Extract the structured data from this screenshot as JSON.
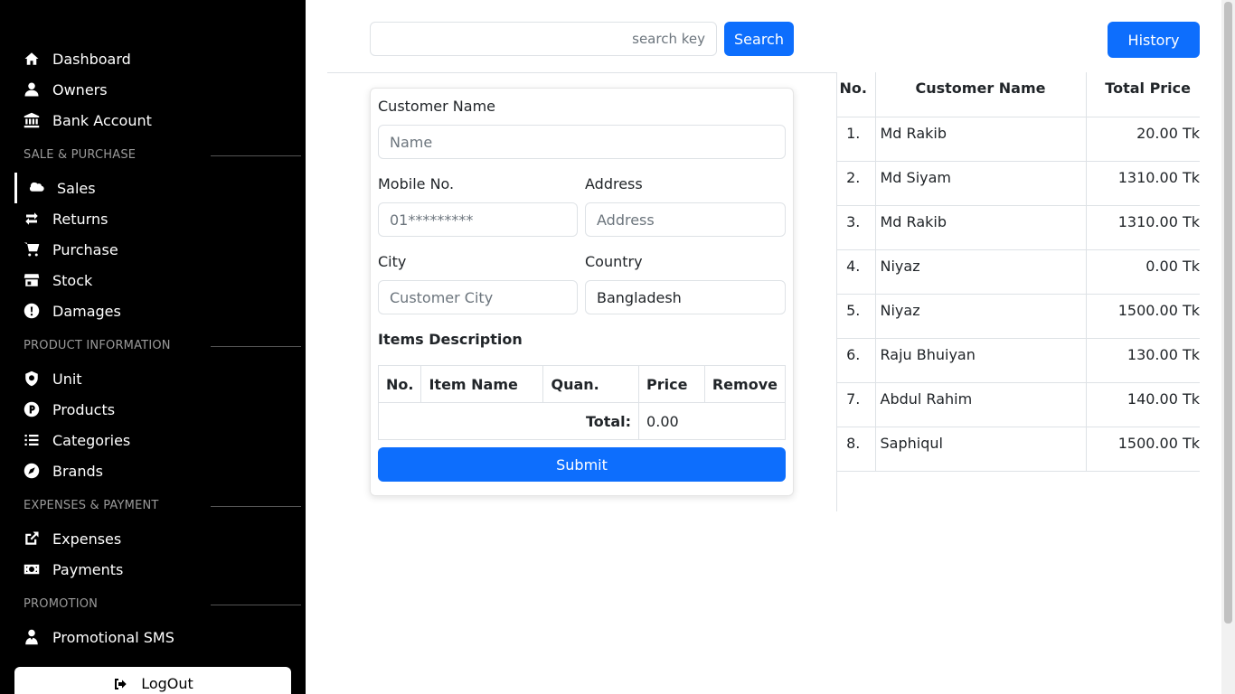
{
  "sidebar": {
    "items": [
      {
        "label": "Dashboard",
        "icon": "home-icon"
      },
      {
        "label": "Owners",
        "icon": "user-icon"
      },
      {
        "label": "Bank Account",
        "icon": "bank-icon"
      },
      {
        "label": "Sales",
        "icon": "salesforce-cloud-icon",
        "active": true
      },
      {
        "label": "Returns",
        "icon": "swap-arrows-icon"
      },
      {
        "label": "Purchase",
        "icon": "cart-icon"
      },
      {
        "label": "Stock",
        "icon": "store-icon"
      },
      {
        "label": "Damages",
        "icon": "alert-circle-icon"
      },
      {
        "label": "Unit",
        "icon": "shield-icon"
      },
      {
        "label": "Products",
        "icon": "product-p-icon"
      },
      {
        "label": "Categories",
        "icon": "list-icon"
      },
      {
        "label": "Brands",
        "icon": "compass-icon"
      },
      {
        "label": "Expenses",
        "icon": "external-link-icon"
      },
      {
        "label": "Payments",
        "icon": "money-bill-icon"
      },
      {
        "label": "Promotional SMS",
        "icon": "user-tie-icon"
      }
    ],
    "sections": [
      "SALE & PURCHASE",
      "PRODUCT INFORMATION",
      "EXPENSES & PAYMENT",
      "PROMOTION"
    ],
    "logout_label": "LogOut"
  },
  "topbar": {
    "search_placeholder": "search key",
    "search_button": "Search",
    "history_button": "History"
  },
  "form": {
    "customer_name_label": "Customer Name",
    "customer_name_placeholder": "Name",
    "mobile_label": "Mobile No.",
    "mobile_placeholder": "01*********",
    "address_label": "Address",
    "address_placeholder": "Address",
    "city_label": "City",
    "city_placeholder": "Customer City",
    "country_label": "Country",
    "country_value": "Bangladesh",
    "items_title": "Items Description",
    "items_headers": [
      "No.",
      "Item Name",
      "Quan.",
      "Price",
      "Remove"
    ],
    "total_label": "Total:",
    "total_value": "0.00",
    "submit_label": "Submit"
  },
  "history": {
    "headers": [
      "No.",
      "Customer Name",
      "Total Price"
    ],
    "rows": [
      {
        "no": "1.",
        "name": "Md Rakib",
        "price": "20.00 Tk"
      },
      {
        "no": "2.",
        "name": "Md Siyam",
        "price": "1310.00 Tk"
      },
      {
        "no": "3.",
        "name": "Md Rakib",
        "price": "1310.00 Tk"
      },
      {
        "no": "4.",
        "name": "Niyaz",
        "price": "0.00 Tk"
      },
      {
        "no": "5.",
        "name": "Niyaz",
        "price": "1500.00 Tk"
      },
      {
        "no": "6.",
        "name": "Raju Bhuiyan",
        "price": "130.00 Tk"
      },
      {
        "no": "7.",
        "name": "Abdul Rahim",
        "price": "140.00 Tk"
      },
      {
        "no": "8.",
        "name": "Saphiqul",
        "price": "1500.00 Tk"
      }
    ]
  }
}
